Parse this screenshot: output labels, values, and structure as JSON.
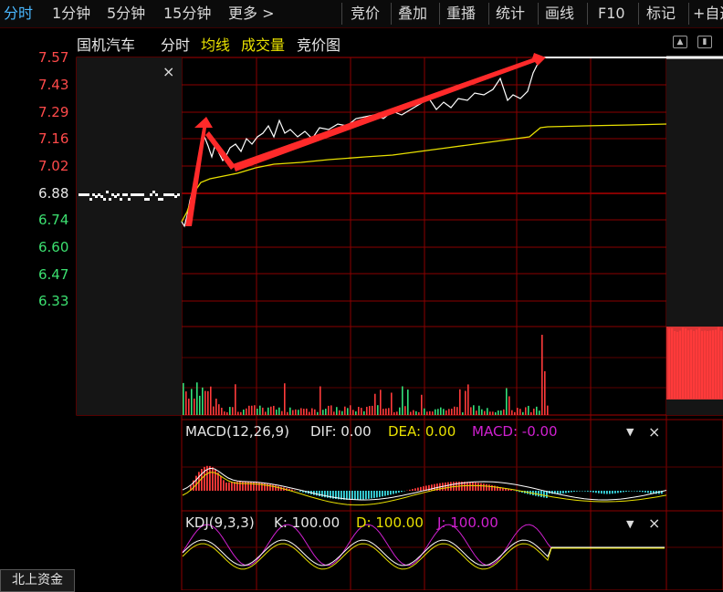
{
  "toolbar": {
    "left_tabs": [
      "分时",
      "1分钟",
      "5分钟",
      "15分钟",
      "更多 >"
    ],
    "right_buttons": [
      "竞价",
      "叠加",
      "重播",
      "统计",
      "画线",
      "F10",
      "标记",
      "+自选"
    ]
  },
  "subheader": {
    "stock_name": "国机汽车",
    "mode": "分时",
    "avg_label": "均线",
    "volume_label": "成交量",
    "auction_label": "竞价图"
  },
  "price_axis": [
    "7.57",
    "7.43",
    "7.29",
    "7.16",
    "7.02",
    "6.88",
    "6.74",
    "6.60",
    "6.47",
    "6.33"
  ],
  "close_mark": "×",
  "macd": {
    "title": "MACD(12,26,9)",
    "dif": "DIF: 0.00",
    "dea": "DEA: 0.00",
    "macd": "MACD: -0.00"
  },
  "kdj": {
    "title": "KDJ(9,3,3)",
    "k": "K: 100.00",
    "d": "D: 100.00",
    "j": "J: 100.00"
  },
  "controls": {
    "dropdown": "▼",
    "close": "×"
  },
  "bottom_tab": "北上资金",
  "colors": {
    "up": "#ff3b3b",
    "down": "#33e07a",
    "grid": "#8b0000",
    "avg_line": "#e8e000",
    "price_line": "#ffffff",
    "dea": "#e8e000",
    "macd_label": "#d020d0",
    "axis_up": "#ff4a4a",
    "axis_down": "#3ce070"
  }
}
